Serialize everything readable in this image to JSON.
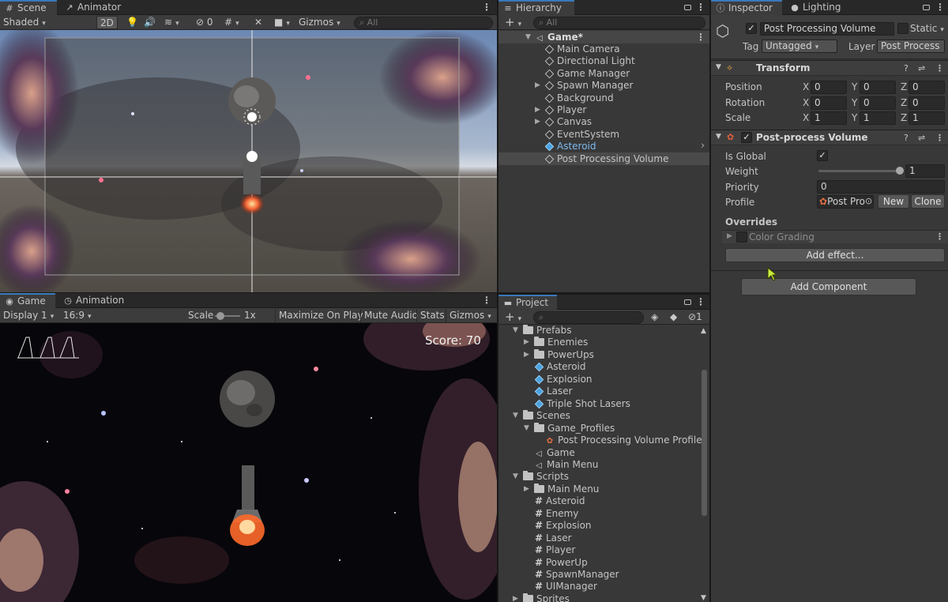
{
  "scene": {
    "tabs": [
      "Scene",
      "Animator"
    ],
    "shading_mode": "Shaded",
    "btn_2d": "2D",
    "hidden_count": "0",
    "gizmos": "Gizmos",
    "search_placeholder": "All"
  },
  "game": {
    "tabs": [
      "Game",
      "Animation"
    ],
    "display": "Display 1",
    "aspect": "16:9",
    "scale_label": "Scale",
    "scale_value": "1x",
    "maximize": "Maximize On Play",
    "mute": "Mute Audio",
    "stats": "Stats",
    "gizmos": "Gizmos",
    "score": "Score: 70"
  },
  "hierarchy": {
    "tab": "Hierarchy",
    "search_placeholder": "All",
    "root": "Game*",
    "items": [
      {
        "label": "Main Camera",
        "expandable": false
      },
      {
        "label": "Directional Light",
        "expandable": false
      },
      {
        "label": "Game Manager",
        "expandable": false
      },
      {
        "label": "Spawn Manager",
        "expandable": true
      },
      {
        "label": "Background",
        "expandable": false
      },
      {
        "label": "Player",
        "expandable": true
      },
      {
        "label": "Canvas",
        "expandable": true
      },
      {
        "label": "EventSystem",
        "expandable": false
      },
      {
        "label": "Asteroid",
        "expandable": false,
        "prefab": true
      },
      {
        "label": "Post Processing Volume",
        "expandable": false,
        "selected": true
      }
    ]
  },
  "project": {
    "tab": "Project",
    "hidden_count": "1",
    "items": [
      {
        "label": "Prefabs",
        "icon": "folder",
        "depth": 0,
        "expanded": true
      },
      {
        "label": "Enemies",
        "icon": "folder",
        "depth": 1,
        "expandable": true
      },
      {
        "label": "PowerUps",
        "icon": "folder",
        "depth": 1,
        "expandable": true
      },
      {
        "label": "Asteroid",
        "icon": "prefab",
        "depth": 1
      },
      {
        "label": "Explosion",
        "icon": "prefab",
        "depth": 1
      },
      {
        "label": "Laser",
        "icon": "prefab",
        "depth": 1
      },
      {
        "label": "Triple Shot Lasers",
        "icon": "prefab",
        "depth": 1
      },
      {
        "label": "Scenes",
        "icon": "folder",
        "depth": 0,
        "expanded": true
      },
      {
        "label": "Game_Profiles",
        "icon": "folder",
        "depth": 1,
        "expanded": true
      },
      {
        "label": "Post Processing Volume Profile",
        "icon": "profile",
        "depth": 2
      },
      {
        "label": "Game",
        "icon": "unity",
        "depth": 1
      },
      {
        "label": "Main Menu",
        "icon": "unity",
        "depth": 1
      },
      {
        "label": "Scripts",
        "icon": "folder",
        "depth": 0,
        "expanded": true
      },
      {
        "label": "Main Menu",
        "icon": "folder",
        "depth": 1,
        "expandable": true
      },
      {
        "label": "Asteroid",
        "icon": "script",
        "depth": 1
      },
      {
        "label": "Enemy",
        "icon": "script",
        "depth": 1
      },
      {
        "label": "Explosion",
        "icon": "script",
        "depth": 1
      },
      {
        "label": "Laser",
        "icon": "script",
        "depth": 1
      },
      {
        "label": "Player",
        "icon": "script",
        "depth": 1
      },
      {
        "label": "PowerUp",
        "icon": "script",
        "depth": 1
      },
      {
        "label": "SpawnManager",
        "icon": "script",
        "depth": 1
      },
      {
        "label": "UIManager",
        "icon": "script",
        "depth": 1
      },
      {
        "label": "Sprites",
        "icon": "folder",
        "depth": 0,
        "expandable": true
      }
    ]
  },
  "inspector": {
    "tabs": [
      "Inspector",
      "Lighting"
    ],
    "object_name": "Post Processing Volume",
    "static_label": "Static",
    "tag_label": "Tag",
    "tag_value": "Untagged",
    "layer_label": "Layer",
    "layer_value": "Post Process",
    "transform": {
      "title": "Transform",
      "rows": [
        {
          "label": "Position",
          "x": "0",
          "y": "0",
          "z": "0"
        },
        {
          "label": "Rotation",
          "x": "0",
          "y": "0",
          "z": "0"
        },
        {
          "label": "Scale",
          "x": "1",
          "y": "1",
          "z": "1"
        }
      ],
      "axis": [
        "X",
        "Y",
        "Z"
      ]
    },
    "volume": {
      "title": "Post-process Volume",
      "is_global_label": "Is Global",
      "weight_label": "Weight",
      "weight_value": "1",
      "weight": 1.0,
      "priority_label": "Priority",
      "priority_value": "0",
      "profile_label": "Profile",
      "profile_value": "Post Pro",
      "new_btn": "New",
      "clone_btn": "Clone",
      "overrides_label": "Overrides",
      "effect": "Color Grading",
      "add_effect": "Add effect..."
    },
    "add_component": "Add Component"
  }
}
